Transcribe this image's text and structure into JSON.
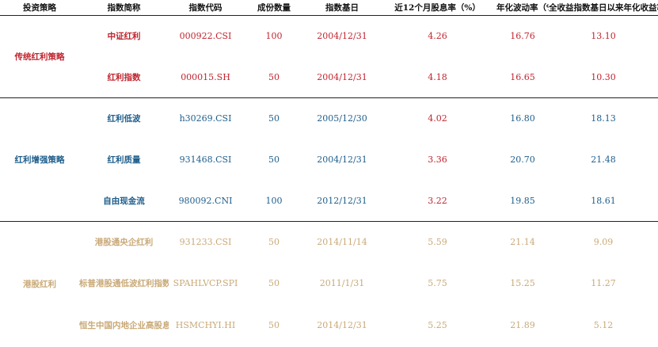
{
  "colors": {
    "header_text": "#111111",
    "traditional": "#c0242e",
    "enhanced": "#1e5e8c",
    "hk": "#c9a977",
    "yield_highlight": "#c0242e",
    "rule": "#222222"
  },
  "headers": [
    "投资策略",
    "指数简称",
    "指数代码",
    "成份数量",
    "指数基日",
    "近12个月股息率（%）",
    "年化波动率（%）",
    "全收益指数基日以来年化收益率（%）"
  ],
  "groups": [
    {
      "strategy": "传统红利策略",
      "color_key": "traditional",
      "rows": [
        {
          "name": "中证红利",
          "code": "000922.CSI",
          "count": "100",
          "base_date": "2004/12/31",
          "yield": "4.26",
          "volatility": "16.76",
          "annual_return": "13.10"
        },
        {
          "name": "红利指数",
          "code": "000015.SH",
          "count": "50",
          "base_date": "2004/12/31",
          "yield": "4.18",
          "volatility": "16.65",
          "annual_return": "10.30"
        }
      ]
    },
    {
      "strategy": "红利增强策略",
      "color_key": "enhanced",
      "yield_color_key": "yield_highlight",
      "rows": [
        {
          "name": "红利低波",
          "code": "h30269.CSI",
          "count": "50",
          "base_date": "2005/12/30",
          "yield": "4.02",
          "volatility": "16.80",
          "annual_return": "18.13"
        },
        {
          "name": "红利质量",
          "code": "931468.CSI",
          "count": "50",
          "base_date": "2004/12/31",
          "yield": "3.36",
          "volatility": "20.70",
          "annual_return": "21.48"
        },
        {
          "name": "自由现金流",
          "code": "980092.CNI",
          "count": "100",
          "base_date": "2012/12/31",
          "yield": "3.22",
          "volatility": "19.85",
          "annual_return": "18.61"
        }
      ]
    },
    {
      "strategy": "港股红利",
      "color_key": "hk",
      "rows": [
        {
          "name": "港股通央企红利",
          "code": "931233.CSI",
          "count": "50",
          "base_date": "2014/11/14",
          "yield": "5.59",
          "volatility": "21.14",
          "annual_return": "9.09"
        },
        {
          "name": "标普港股通低波红利指数",
          "code": "SPAHLVCP.SPI",
          "count": "50",
          "base_date": "2011/1/31",
          "yield": "5.75",
          "volatility": "15.25",
          "annual_return": "11.27"
        },
        {
          "name": "恒生中国内地企业高股息率",
          "code": "HSMCHYI.HI",
          "count": "50",
          "base_date": "2014/12/31",
          "yield": "5.25",
          "volatility": "21.89",
          "annual_return": "5.12"
        }
      ]
    }
  ]
}
